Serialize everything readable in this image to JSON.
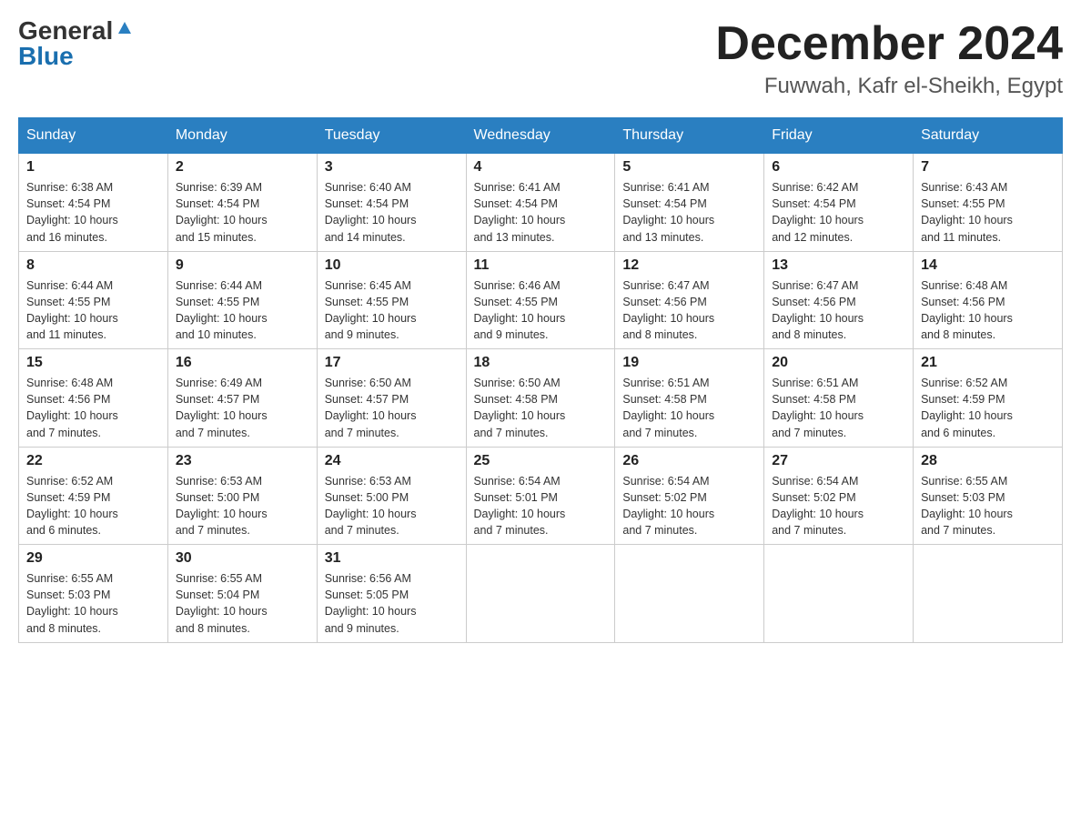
{
  "header": {
    "logo_general": "General",
    "logo_blue": "Blue",
    "month_title": "December 2024",
    "location": "Fuwwah, Kafr el-Sheikh, Egypt"
  },
  "days_of_week": [
    "Sunday",
    "Monday",
    "Tuesday",
    "Wednesday",
    "Thursday",
    "Friday",
    "Saturday"
  ],
  "weeks": [
    [
      {
        "day": "1",
        "sunrise": "6:38 AM",
        "sunset": "4:54 PM",
        "daylight": "10 hours and 16 minutes."
      },
      {
        "day": "2",
        "sunrise": "6:39 AM",
        "sunset": "4:54 PM",
        "daylight": "10 hours and 15 minutes."
      },
      {
        "day": "3",
        "sunrise": "6:40 AM",
        "sunset": "4:54 PM",
        "daylight": "10 hours and 14 minutes."
      },
      {
        "day": "4",
        "sunrise": "6:41 AM",
        "sunset": "4:54 PM",
        "daylight": "10 hours and 13 minutes."
      },
      {
        "day": "5",
        "sunrise": "6:41 AM",
        "sunset": "4:54 PM",
        "daylight": "10 hours and 13 minutes."
      },
      {
        "day": "6",
        "sunrise": "6:42 AM",
        "sunset": "4:54 PM",
        "daylight": "10 hours and 12 minutes."
      },
      {
        "day": "7",
        "sunrise": "6:43 AM",
        "sunset": "4:55 PM",
        "daylight": "10 hours and 11 minutes."
      }
    ],
    [
      {
        "day": "8",
        "sunrise": "6:44 AM",
        "sunset": "4:55 PM",
        "daylight": "10 hours and 11 minutes."
      },
      {
        "day": "9",
        "sunrise": "6:44 AM",
        "sunset": "4:55 PM",
        "daylight": "10 hours and 10 minutes."
      },
      {
        "day": "10",
        "sunrise": "6:45 AM",
        "sunset": "4:55 PM",
        "daylight": "10 hours and 9 minutes."
      },
      {
        "day": "11",
        "sunrise": "6:46 AM",
        "sunset": "4:55 PM",
        "daylight": "10 hours and 9 minutes."
      },
      {
        "day": "12",
        "sunrise": "6:47 AM",
        "sunset": "4:56 PM",
        "daylight": "10 hours and 8 minutes."
      },
      {
        "day": "13",
        "sunrise": "6:47 AM",
        "sunset": "4:56 PM",
        "daylight": "10 hours and 8 minutes."
      },
      {
        "day": "14",
        "sunrise": "6:48 AM",
        "sunset": "4:56 PM",
        "daylight": "10 hours and 8 minutes."
      }
    ],
    [
      {
        "day": "15",
        "sunrise": "6:48 AM",
        "sunset": "4:56 PM",
        "daylight": "10 hours and 7 minutes."
      },
      {
        "day": "16",
        "sunrise": "6:49 AM",
        "sunset": "4:57 PM",
        "daylight": "10 hours and 7 minutes."
      },
      {
        "day": "17",
        "sunrise": "6:50 AM",
        "sunset": "4:57 PM",
        "daylight": "10 hours and 7 minutes."
      },
      {
        "day": "18",
        "sunrise": "6:50 AM",
        "sunset": "4:58 PM",
        "daylight": "10 hours and 7 minutes."
      },
      {
        "day": "19",
        "sunrise": "6:51 AM",
        "sunset": "4:58 PM",
        "daylight": "10 hours and 7 minutes."
      },
      {
        "day": "20",
        "sunrise": "6:51 AM",
        "sunset": "4:58 PM",
        "daylight": "10 hours and 7 minutes."
      },
      {
        "day": "21",
        "sunrise": "6:52 AM",
        "sunset": "4:59 PM",
        "daylight": "10 hours and 6 minutes."
      }
    ],
    [
      {
        "day": "22",
        "sunrise": "6:52 AM",
        "sunset": "4:59 PM",
        "daylight": "10 hours and 6 minutes."
      },
      {
        "day": "23",
        "sunrise": "6:53 AM",
        "sunset": "5:00 PM",
        "daylight": "10 hours and 7 minutes."
      },
      {
        "day": "24",
        "sunrise": "6:53 AM",
        "sunset": "5:00 PM",
        "daylight": "10 hours and 7 minutes."
      },
      {
        "day": "25",
        "sunrise": "6:54 AM",
        "sunset": "5:01 PM",
        "daylight": "10 hours and 7 minutes."
      },
      {
        "day": "26",
        "sunrise": "6:54 AM",
        "sunset": "5:02 PM",
        "daylight": "10 hours and 7 minutes."
      },
      {
        "day": "27",
        "sunrise": "6:54 AM",
        "sunset": "5:02 PM",
        "daylight": "10 hours and 7 minutes."
      },
      {
        "day": "28",
        "sunrise": "6:55 AM",
        "sunset": "5:03 PM",
        "daylight": "10 hours and 7 minutes."
      }
    ],
    [
      {
        "day": "29",
        "sunrise": "6:55 AM",
        "sunset": "5:03 PM",
        "daylight": "10 hours and 8 minutes."
      },
      {
        "day": "30",
        "sunrise": "6:55 AM",
        "sunset": "5:04 PM",
        "daylight": "10 hours and 8 minutes."
      },
      {
        "day": "31",
        "sunrise": "6:56 AM",
        "sunset": "5:05 PM",
        "daylight": "10 hours and 9 minutes."
      },
      null,
      null,
      null,
      null
    ]
  ]
}
